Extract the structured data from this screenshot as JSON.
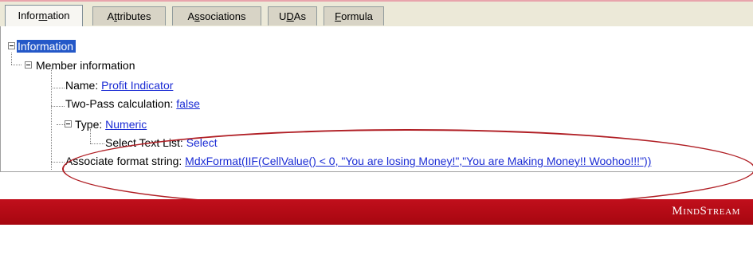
{
  "tabs": [
    {
      "pre": "Infor",
      "key": "m",
      "post": "ation",
      "active": true
    },
    {
      "pre": "A",
      "key": "t",
      "post": "tributes",
      "active": false
    },
    {
      "pre": "A",
      "key": "s",
      "post": "sociations",
      "active": false
    },
    {
      "pre": "U",
      "key": "D",
      "post": "As",
      "active": false
    },
    {
      "pre": "",
      "key": "F",
      "post": "ormula",
      "active": false
    }
  ],
  "tree": {
    "root": "Information",
    "member_info": "Member information",
    "name_label": "Name:",
    "name_value": "Profit Indicator",
    "twopass_label": "Two-Pass calculation:",
    "twopass_value": "false",
    "type_label": "Type:",
    "type_value": "Numeric",
    "select_label": "Select Text List:",
    "select_value": "Select",
    "format_label": "Associate format string:",
    "format_value": "MdxFormat(IIF(CellValue() < 0, \"You are losing Money!\",\"You are Making Money!! Woohoo!!!\"))"
  },
  "footer": {
    "brand": "MindStream",
    "bar_color": "#b20a17"
  }
}
